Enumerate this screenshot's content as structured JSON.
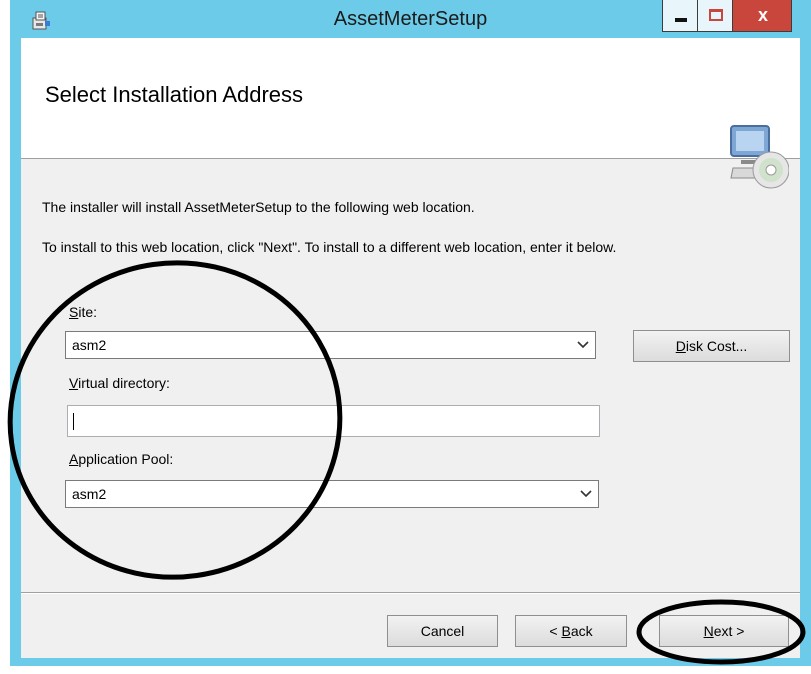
{
  "window": {
    "title": "AssetMeterSetup",
    "close_glyph": "x"
  },
  "banner": {
    "title": "Select Installation Address"
  },
  "body": {
    "line1": "The installer will install AssetMeterSetup to the following web location.",
    "line2": "To install to this web location, click \"Next\". To install to a different web location, enter it below."
  },
  "form": {
    "site": {
      "label_accel": "S",
      "label_rest": "ite:",
      "value": "asm2"
    },
    "virtual_directory": {
      "label_accel": "V",
      "label_rest": "irtual directory:",
      "value": ""
    },
    "application_pool": {
      "label_accel": "A",
      "label_rest": "pplication Pool:",
      "value": "asm2"
    }
  },
  "buttons": {
    "disk_cost": {
      "accel": "D",
      "rest": "isk Cost..."
    },
    "cancel": {
      "label": "Cancel"
    },
    "back": {
      "pre": "< ",
      "accel": "B",
      "rest": "ack"
    },
    "next": {
      "accel": "N",
      "rest": "ext >"
    }
  },
  "colors": {
    "frame": "#6ccbe8",
    "client": "#f0f0f0",
    "close_button": "#c9463c",
    "annotation": "#000000"
  }
}
